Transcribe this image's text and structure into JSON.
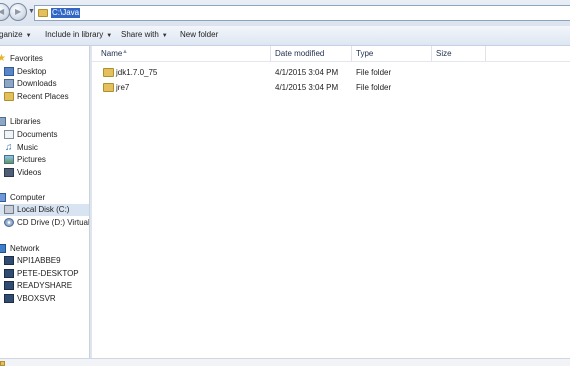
{
  "address_bar": {
    "path": "C:\\Java"
  },
  "toolbar": {
    "organize_label": "ganize",
    "include_label": "Include in library",
    "share_label": "Share with",
    "new_folder_label": "New folder"
  },
  "nav_pane": {
    "favorites": {
      "label": "Favorites",
      "items": [
        {
          "label": "Desktop",
          "icon": "desktop-icon"
        },
        {
          "label": "Downloads",
          "icon": "downloads-icon"
        },
        {
          "label": "Recent Places",
          "icon": "recent-places-icon"
        }
      ]
    },
    "libraries": {
      "label": "Libraries",
      "items": [
        {
          "label": "Documents",
          "icon": "documents-icon"
        },
        {
          "label": "Music",
          "icon": "music-icon"
        },
        {
          "label": "Pictures",
          "icon": "pictures-icon"
        },
        {
          "label": "Videos",
          "icon": "videos-icon"
        }
      ]
    },
    "computer": {
      "label": "Computer",
      "items": [
        {
          "label": "Local Disk (C:)",
          "icon": "disk-icon",
          "selected": true
        },
        {
          "label": "CD Drive (D:) VirtualBo",
          "icon": "cd-drive-icon"
        }
      ]
    },
    "network": {
      "label": "Network",
      "items": [
        {
          "label": "NPI1ABBE9",
          "icon": "network-computer-icon"
        },
        {
          "label": "PETE-DESKTOP",
          "icon": "network-computer-icon"
        },
        {
          "label": "READYSHARE",
          "icon": "network-computer-icon"
        },
        {
          "label": "VBOXSVR",
          "icon": "network-computer-icon"
        }
      ]
    }
  },
  "file_list": {
    "columns": [
      "Name",
      "Date modified",
      "Type",
      "Size"
    ],
    "rows": [
      {
        "name": "jdk1.7.0_75",
        "date_modified": "4/1/2015 3:04 PM",
        "type": "File folder",
        "size": ""
      },
      {
        "name": "jre7",
        "date_modified": "4/1/2015 3:04 PM",
        "type": "File folder",
        "size": ""
      }
    ]
  },
  "colors": {
    "selection": "#3166c4",
    "nav_selected": "#d9e4f2",
    "folder": "#e3c05d"
  }
}
